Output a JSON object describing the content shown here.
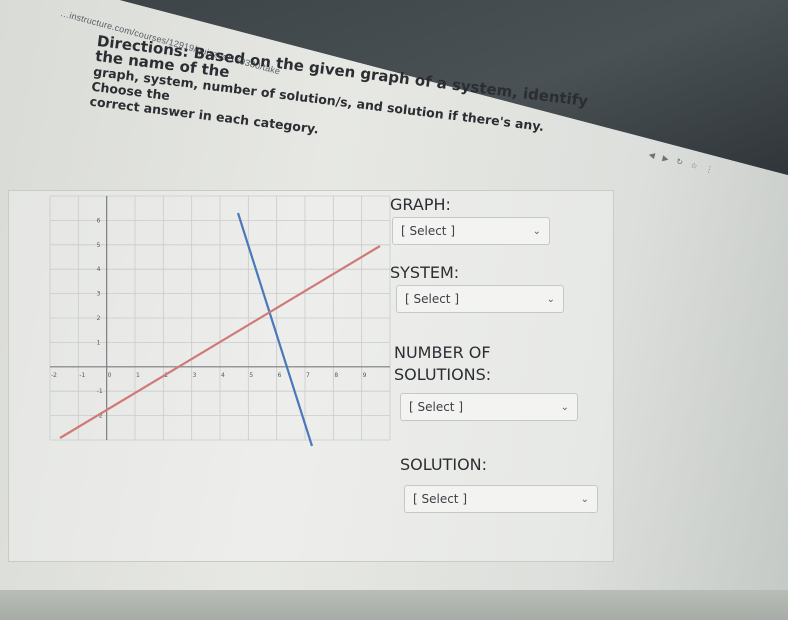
{
  "browser": {
    "url": "…instructure.com/courses/12919/quizzes/169380/take"
  },
  "question": {
    "directions_head": "Directions: Based on the given graph of a system, identify the name of the",
    "directions_line2": "graph, system, number of solution/s, and solution if there's any. Choose the",
    "directions_line3": "correct answer in each category."
  },
  "fields": [
    {
      "label": "GRAPH:",
      "placeholder": "[ Select ]"
    },
    {
      "label": "SYSTEM:",
      "placeholder": "[ Select ]"
    },
    {
      "label_line1": "NUMBER OF",
      "label_line2": "SOLUTIONS:",
      "placeholder": "[ Select ]"
    },
    {
      "label": "SOLUTION:",
      "placeholder": "[ Select ]"
    }
  ],
  "graph": {
    "x_ticks": [
      "-2",
      "-1",
      "0",
      "1",
      "2",
      "3",
      "4",
      "5",
      "6",
      "7",
      "8",
      "9"
    ],
    "y_ticks": [
      "6",
      "5",
      "4",
      "3",
      "2",
      "1",
      "-1",
      "-2"
    ],
    "line_colors": {
      "blue": "#4a78b8",
      "red": "#d07a78"
    }
  },
  "icons": [
    "back-icon",
    "forward-icon",
    "refresh-icon",
    "star-icon",
    "menu-icon"
  ]
}
